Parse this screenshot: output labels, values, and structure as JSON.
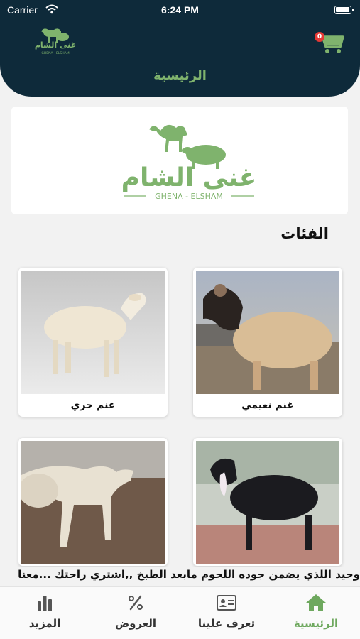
{
  "status_bar": {
    "carrier": "Carrier",
    "time": "6:24 PM"
  },
  "header": {
    "title": "الرئيسية",
    "cart_count": "0",
    "logo_text": "غنى الشام",
    "logo_sub": "GHENA - ELSHAM"
  },
  "brand": {
    "name": "غنى الشام",
    "subtitle": "GHENA - ELSHAM",
    "color": "#7fb36d"
  },
  "categories": {
    "title": "الفئات",
    "items": [
      {
        "label": "غنم نعيمي"
      },
      {
        "label": "غنم حري"
      },
      {
        "label": ""
      },
      {
        "label": ""
      }
    ]
  },
  "marquee": {
    "text": "وحيد اللذي يضمن جوده اللحوم مابعد الطبخ ,,اشتري راحتك ...معنا"
  },
  "tabs": [
    {
      "label": "الرئيسية",
      "icon": "home-icon",
      "active": true
    },
    {
      "label": "تعرف علينا",
      "icon": "contact-card-icon",
      "active": false
    },
    {
      "label": "العروض",
      "icon": "percent-icon",
      "active": false
    },
    {
      "label": "المزيد",
      "icon": "bar-chart-icon",
      "active": false
    }
  ],
  "colors": {
    "header_bg": "#0e2a3a",
    "accent": "#6ea85e",
    "badge": "#e53935"
  }
}
